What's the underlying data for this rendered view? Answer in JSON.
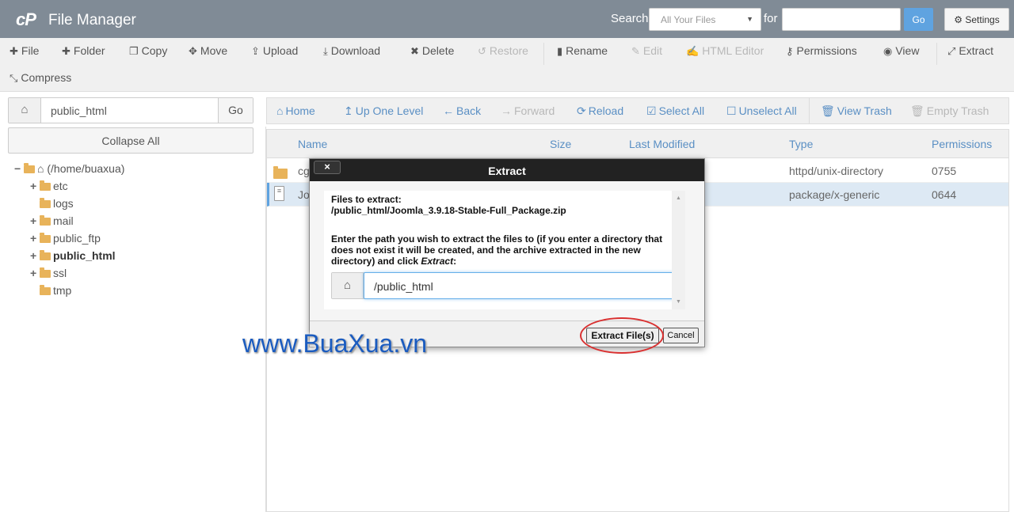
{
  "header": {
    "logo": "cP",
    "title": "File Manager",
    "search_label": "Search",
    "search_scope": "All Your Files",
    "for_label": "for",
    "search_value": "",
    "go_label": "Go",
    "settings_label": "Settings"
  },
  "toolbar": {
    "file": "File",
    "folder": "Folder",
    "copy": "Copy",
    "move": "Move",
    "upload": "Upload",
    "download": "Download",
    "delete": "Delete",
    "restore": "Restore",
    "rename": "Rename",
    "edit": "Edit",
    "html_editor": "HTML Editor",
    "permissions": "Permissions",
    "view": "View",
    "extract": "Extract",
    "compress": "Compress"
  },
  "sidebar": {
    "path_value": "public_html",
    "go_label": "Go",
    "collapse_label": "Collapse All",
    "root": "(/home/buaxua)",
    "items": [
      {
        "toggle": "+",
        "label": "etc"
      },
      {
        "toggle": "",
        "label": "logs"
      },
      {
        "toggle": "+",
        "label": "mail"
      },
      {
        "toggle": "+",
        "label": "public_ftp"
      },
      {
        "toggle": "+",
        "label": "public_html"
      },
      {
        "toggle": "+",
        "label": "ssl"
      },
      {
        "toggle": "",
        "label": "tmp"
      }
    ]
  },
  "nav": {
    "home": "Home",
    "up": "Up One Level",
    "back": "Back",
    "forward": "Forward",
    "reload": "Reload",
    "select_all": "Select All",
    "unselect_all": "Unselect All",
    "view_trash": "View Trash",
    "empty_trash": "Empty Trash"
  },
  "table": {
    "headers": {
      "name": "Name",
      "size": "Size",
      "modified": "Last Modified",
      "type": "Type",
      "permissions": "Permissions"
    },
    "rows": [
      {
        "name": "cg",
        "type": "httpd/unix-directory",
        "perms": "0755"
      },
      {
        "name": "Jo",
        "type": "package/x-generic",
        "perms": "0644"
      }
    ]
  },
  "modal": {
    "title": "Extract",
    "close": "×",
    "files_label": "Files to extract:",
    "file_path": "/public_html/Joomla_3.9.18-Stable-Full_Package.zip",
    "instructions_1": "Enter the path you wish to extract the files to (if you enter a directory that",
    "instructions_2": "does not exist it will be created, and the archive extracted in the new",
    "instructions_3a": "directory) and click ",
    "instructions_3b": "Extract",
    "instructions_3c": ":",
    "path_value": "/public_html",
    "extract_button": "Extract File(s)",
    "cancel_button": "Cancel"
  },
  "watermark": "www.BuaXua.vn",
  "colors": {
    "header": "#808b96",
    "accent": "#5fa3e0",
    "link": "#5a8fc4",
    "highlight_ring": "#d93030"
  }
}
